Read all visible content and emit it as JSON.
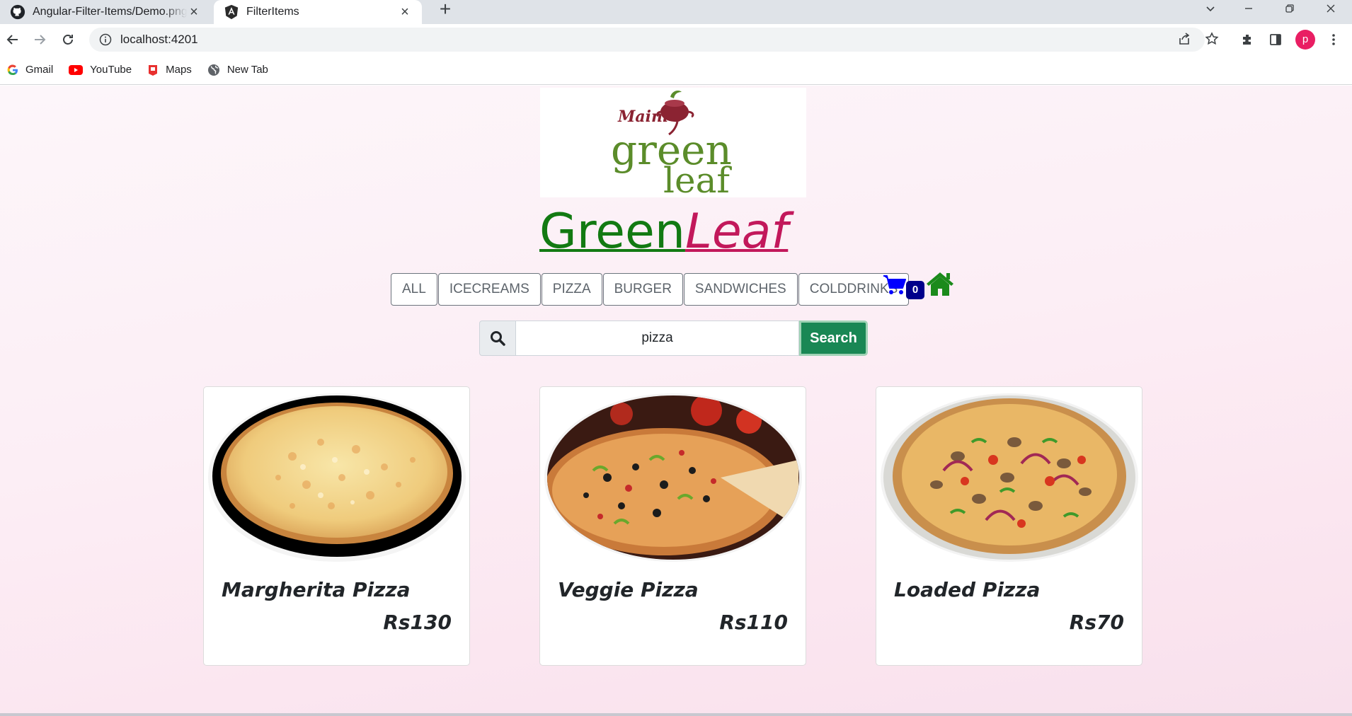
{
  "browser": {
    "tabs": [
      {
        "title": "Angular-Filter-Items/Demo.png a",
        "icon": "github-icon"
      },
      {
        "title": "FilterItems",
        "icon": "angular-icon"
      }
    ],
    "url": "localhost:4201",
    "profile_initial": "p",
    "bookmarks": [
      {
        "label": "Gmail",
        "icon": "google-icon"
      },
      {
        "label": "YouTube",
        "icon": "youtube-icon"
      },
      {
        "label": "Maps",
        "icon": "maps-icon"
      },
      {
        "label": "New Tab",
        "icon": "globe-icon"
      }
    ]
  },
  "page": {
    "logo": {
      "line1": "Maini's",
      "line2": "green",
      "line3": "leaf"
    },
    "brand": {
      "part1": "Green",
      "part2": "Leaf"
    },
    "categories": [
      "ALL",
      "ICECREAMS",
      "PIZZA",
      "BURGER",
      "SANDWICHES",
      "COLDDRINKS"
    ],
    "cart_count": "0",
    "search": {
      "value": "pizza",
      "button": "Search"
    },
    "products": [
      {
        "name": "Margherita Pizza",
        "price": "Rs130"
      },
      {
        "name": "Veggie Pizza",
        "price": "Rs110"
      },
      {
        "name": "Loaded Pizza",
        "price": "Rs70"
      }
    ]
  },
  "colors": {
    "brand_green": "#127a12",
    "brand_pink": "#c2185b",
    "search_button": "#198754",
    "cart_blue": "#0000ff",
    "home_green": "#1b8a1b"
  }
}
